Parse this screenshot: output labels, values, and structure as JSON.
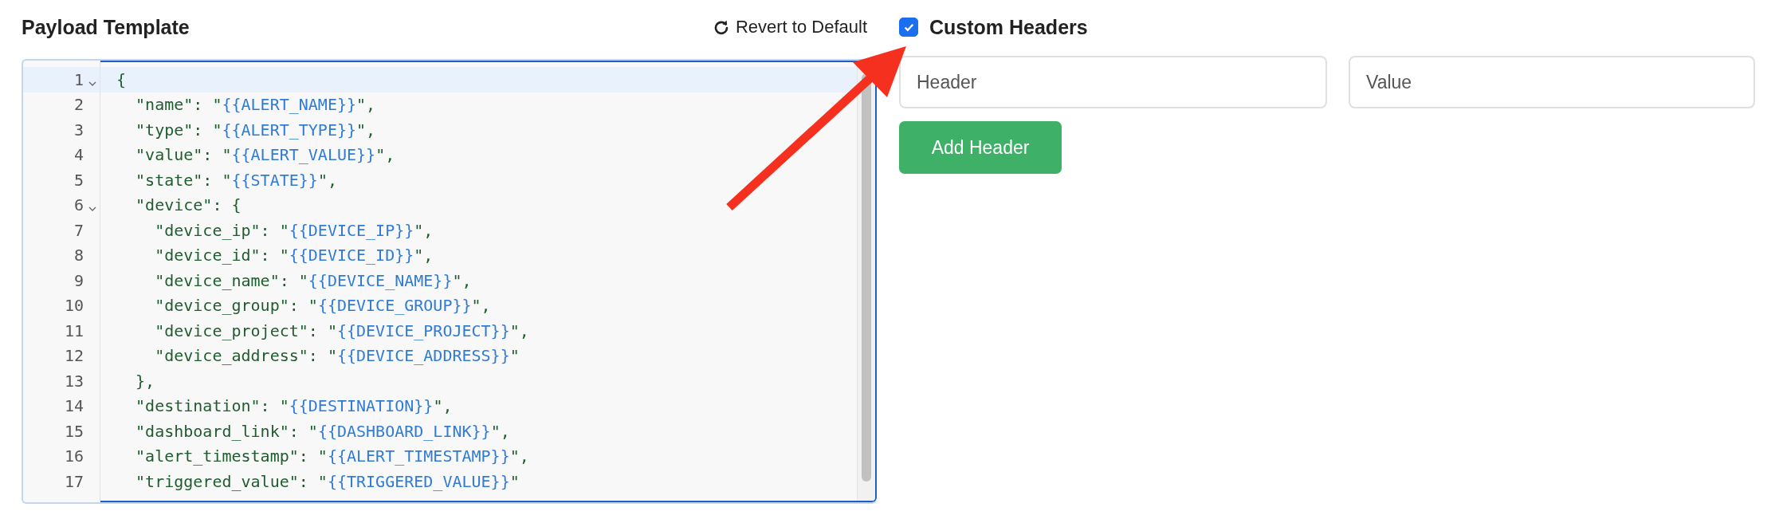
{
  "payload_template": {
    "title": "Payload Template",
    "revert_button": "Revert to Default",
    "editor": {
      "lines": [
        {
          "number": "1",
          "fold": true,
          "active": true,
          "code": "{"
        },
        {
          "number": "2",
          "fold": false,
          "active": false,
          "code": "  \"name\": \"",
          "value": "{{ALERT_NAME}}",
          "after": "\","
        },
        {
          "number": "3",
          "fold": false,
          "active": false,
          "code": "  \"type\": \"",
          "value": "{{ALERT_TYPE}}",
          "after": "\","
        },
        {
          "number": "4",
          "fold": false,
          "active": false,
          "code": "  \"value\": \"",
          "value": "{{ALERT_VALUE}}",
          "after": "\","
        },
        {
          "number": "5",
          "fold": false,
          "active": false,
          "code": "  \"state\": \"",
          "value": "{{STATE}}",
          "after": "\","
        },
        {
          "number": "6",
          "fold": true,
          "active": false,
          "code": "  \"device\": {"
        },
        {
          "number": "7",
          "fold": false,
          "active": false,
          "code": "    \"device_ip\": \"",
          "value": "{{DEVICE_IP}}",
          "after": "\","
        },
        {
          "number": "8",
          "fold": false,
          "active": false,
          "code": "    \"device_id\": \"",
          "value": "{{DEVICE_ID}}",
          "after": "\","
        },
        {
          "number": "9",
          "fold": false,
          "active": false,
          "code": "    \"device_name\": \"",
          "value": "{{DEVICE_NAME}}",
          "after": "\","
        },
        {
          "number": "10",
          "fold": false,
          "active": false,
          "code": "    \"device_group\": \"",
          "value": "{{DEVICE_GROUP}}",
          "after": "\","
        },
        {
          "number": "11",
          "fold": false,
          "active": false,
          "code": "    \"device_project\": \"",
          "value": "{{DEVICE_PROJECT}}",
          "after": "\","
        },
        {
          "number": "12",
          "fold": false,
          "active": false,
          "code": "    \"device_address\": \"",
          "value": "{{DEVICE_ADDRESS}}",
          "after": "\""
        },
        {
          "number": "13",
          "fold": false,
          "active": false,
          "code": "  },"
        },
        {
          "number": "14",
          "fold": false,
          "active": false,
          "code": "  \"destination\": \"",
          "value": "{{DESTINATION}}",
          "after": "\","
        },
        {
          "number": "15",
          "fold": false,
          "active": false,
          "code": "  \"dashboard_link\": \"",
          "value": "{{DASHBOARD_LINK}}",
          "after": "\","
        },
        {
          "number": "16",
          "fold": false,
          "active": false,
          "code": "  \"alert_timestamp\": \"",
          "value": "{{ALERT_TIMESTAMP}}",
          "after": "\","
        },
        {
          "number": "17",
          "fold": false,
          "active": false,
          "code": "  \"triggered_value\": \"",
          "value": "{{TRIGGERED_VALUE}}",
          "after": "\""
        }
      ]
    }
  },
  "custom_headers": {
    "checked": true,
    "label": "Custom Headers",
    "header_field": {
      "placeholder": "Header"
    },
    "value_field": {
      "placeholder": "Value"
    },
    "add_button": "Add Header"
  }
}
